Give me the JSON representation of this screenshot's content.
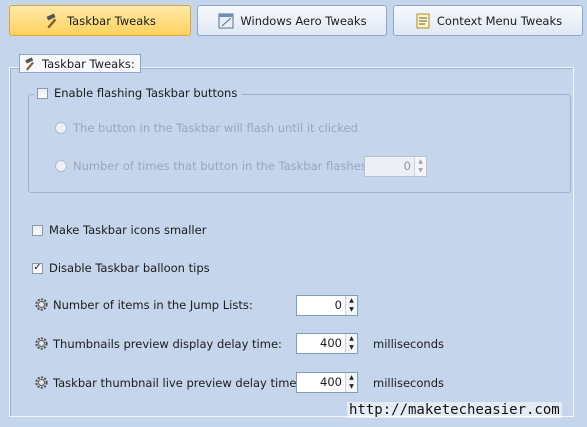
{
  "tabs": [
    {
      "label": "Taskbar Tweaks",
      "icon": "hammer-icon",
      "active": true
    },
    {
      "label": "Windows Aero Tweaks",
      "icon": "window-icon",
      "active": false
    },
    {
      "label": "Context Menu Tweaks",
      "icon": "context-menu-icon",
      "active": false
    }
  ],
  "group": {
    "title": "Taskbar Tweaks:"
  },
  "flashing": {
    "label": "Enable flashing Taskbar buttons",
    "checked": false,
    "option_until_clicked": "The button in the Taskbar will flash until it clicked",
    "option_times": "Number of times that button in the Taskbar flashes:",
    "times_value": "0"
  },
  "options": {
    "smaller_icons": {
      "label": "Make Taskbar icons smaller",
      "checked": false
    },
    "balloon_tips": {
      "label": "Disable Taskbar balloon tips",
      "checked": true
    }
  },
  "settings": [
    {
      "label": "Number of items in the Jump Lists:",
      "value": "0",
      "unit": ""
    },
    {
      "label": "Thumbnails preview display delay time:",
      "value": "400",
      "unit": "milliseconds"
    },
    {
      "label": "Taskbar thumbnail live preview delay time:",
      "value": "400",
      "unit": "milliseconds"
    }
  ],
  "watermark": "http://maketecheasier.com",
  "colors": {
    "background": "#c5d6ec",
    "active_tab": "#ffd25e",
    "border": "#8ea8cc"
  }
}
